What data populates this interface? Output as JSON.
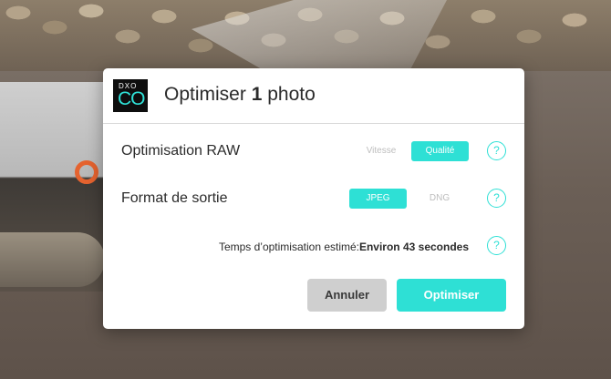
{
  "dialog": {
    "title_prefix": "Optimiser ",
    "title_count": "1",
    "title_suffix": " photo",
    "logo": {
      "top": "DXO",
      "bottom": "CO"
    },
    "raw_row": {
      "label": "Optimisation RAW",
      "options": [
        "Vitesse",
        "Qualité"
      ],
      "selected": "Qualité"
    },
    "format_row": {
      "label": "Format de sortie",
      "options": [
        "JPEG",
        "DNG"
      ],
      "selected": "JPEG"
    },
    "estimate": {
      "label": "Temps d’optimisation estimé:",
      "value": "Environ 43 secondes"
    },
    "help_glyph": "?",
    "buttons": {
      "cancel": "Annuler",
      "ok": "Optimiser"
    }
  },
  "colors": {
    "accent": "#2ee0d5",
    "cancel_bg": "#cfcfcf",
    "text": "#2b2b2b"
  }
}
